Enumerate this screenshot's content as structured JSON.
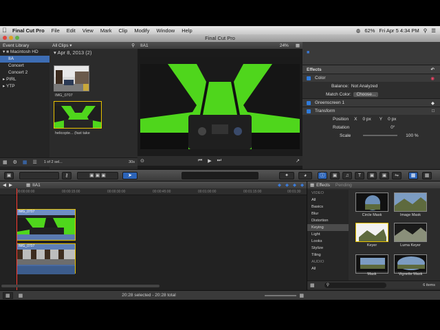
{
  "menubar": {
    "app": "Final Cut Pro",
    "items": [
      "File",
      "Edit",
      "View",
      "Mark",
      "Clip",
      "Modify",
      "Window",
      "Help"
    ],
    "battery": "62%",
    "clock": "Fri Apr 5  4:34 PM"
  },
  "window": {
    "title": "Final Cut Pro"
  },
  "library": {
    "header": "Event Library",
    "drive": "Macintosh HD",
    "items": [
      "IIA",
      "Concert",
      "Concert 2",
      "PIRL",
      "YTP"
    ],
    "selected": "IIA"
  },
  "browser": {
    "filter": "All Clips",
    "date_header": "Apr 8, 2013  (2)",
    "clips": [
      {
        "label": "IMG_0707"
      },
      {
        "label": "helicopte...  (fast take"
      }
    ],
    "selection_count": "1 of 2 sel...",
    "duration": "30s"
  },
  "viewer": {
    "clip_name": "IIA1",
    "zoom": "24%"
  },
  "inspector": {
    "title": "Effects",
    "sections": [
      {
        "label": "Color",
        "type": "section"
      },
      {
        "label": "Balance:",
        "value": "Not Analyzed",
        "type": "row"
      },
      {
        "label": "Match Color:",
        "value": "Choose...",
        "type": "row"
      },
      {
        "label": "Greenscreen 1",
        "type": "section"
      },
      {
        "label": "Transform",
        "type": "section"
      },
      {
        "label": "Position",
        "x_label": "X",
        "x": "0 px",
        "y_label": "Y",
        "y": "0 px",
        "type": "xy"
      },
      {
        "label": "Rotation",
        "value": "0°",
        "type": "row"
      },
      {
        "label": "Scale",
        "value": "100 %",
        "type": "row"
      }
    ]
  },
  "timeline": {
    "name": "IIA1",
    "ruler": [
      "00:00:00:00",
      "00:00:15:00",
      "00:00:30:00",
      "00:00:45:00",
      "00:01:00:00",
      "00:01:15:00",
      "00:01:30"
    ],
    "clips": [
      {
        "label": "IMG_0707",
        "track": "connected"
      },
      {
        "label": "IMG_0707",
        "track": "primary"
      }
    ],
    "status": "20:28 selected - 20:28 total"
  },
  "effects_browser": {
    "tabs": [
      "Effects",
      "Pending"
    ],
    "categories": [
      "VIDEO",
      "All",
      "Basics",
      "Blur",
      "Distortion",
      "Keying",
      "Light",
      "Looks",
      "Stylize",
      "Tiling",
      "AUDIO",
      "All"
    ],
    "selected_category": "Keying",
    "effects": [
      {
        "name": "Circle Mask"
      },
      {
        "name": "Image Mask"
      },
      {
        "name": "Keyer"
      },
      {
        "name": "Luma Keyer"
      },
      {
        "name": "Mask"
      },
      {
        "name": "Vignette Mask"
      }
    ],
    "count": "6 items"
  },
  "colors": {
    "green_screen": "#4fd61c",
    "selection_blue": "#3d6db4",
    "clip_blue": "#5a7ab0",
    "playhead": "#ff3b30"
  }
}
